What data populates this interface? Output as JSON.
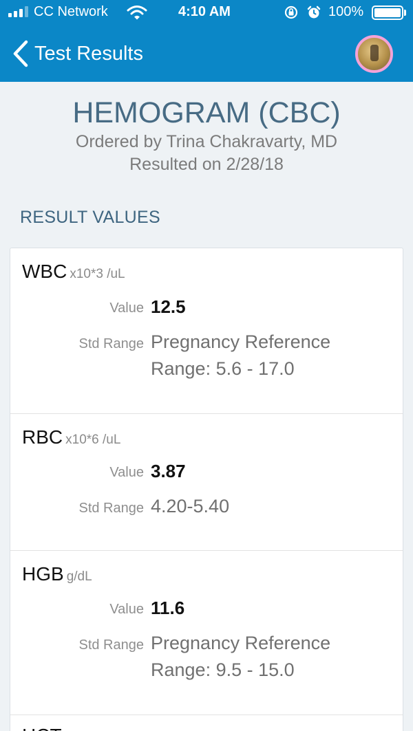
{
  "status_bar": {
    "carrier": "CC Network",
    "time": "4:10 AM",
    "battery": "100%"
  },
  "nav": {
    "back_label": "Test Results"
  },
  "header": {
    "title": "HEMOGRAM (CBC)",
    "ordered_by": "Ordered by Trina Chakravarty, MD",
    "resulted_on": "Resulted on 2/28/18"
  },
  "section_label": "RESULT VALUES",
  "field_labels": {
    "value": "Value",
    "std_range": "Std Range"
  },
  "results": [
    {
      "name": "WBC",
      "unit": "x10*3 /uL",
      "value": "12.5",
      "range_line1": "Pregnancy Reference",
      "range_line2": "Range: 5.6 - 17.0"
    },
    {
      "name": "RBC",
      "unit": "x10*6 /uL",
      "value": "3.87",
      "range_line1": "4.20-5.40",
      "range_line2": ""
    },
    {
      "name": "HGB",
      "unit": "g/dL",
      "value": "11.6",
      "range_line1": "Pregnancy Reference",
      "range_line2": "Range: 9.5 - 15.0"
    },
    {
      "name": "HCT",
      "unit": "",
      "value": "",
      "range_line1": "",
      "range_line2": ""
    }
  ],
  "colors": {
    "header_blue": "#0b87c7",
    "title_slate": "#476b84",
    "background": "#eef2f5",
    "avatar_ring": "#f3a3d8"
  },
  "icons": [
    "signal-bars-icon",
    "wifi-icon",
    "rotation-lock-icon",
    "alarm-icon",
    "battery-icon",
    "chevron-left-icon"
  ]
}
